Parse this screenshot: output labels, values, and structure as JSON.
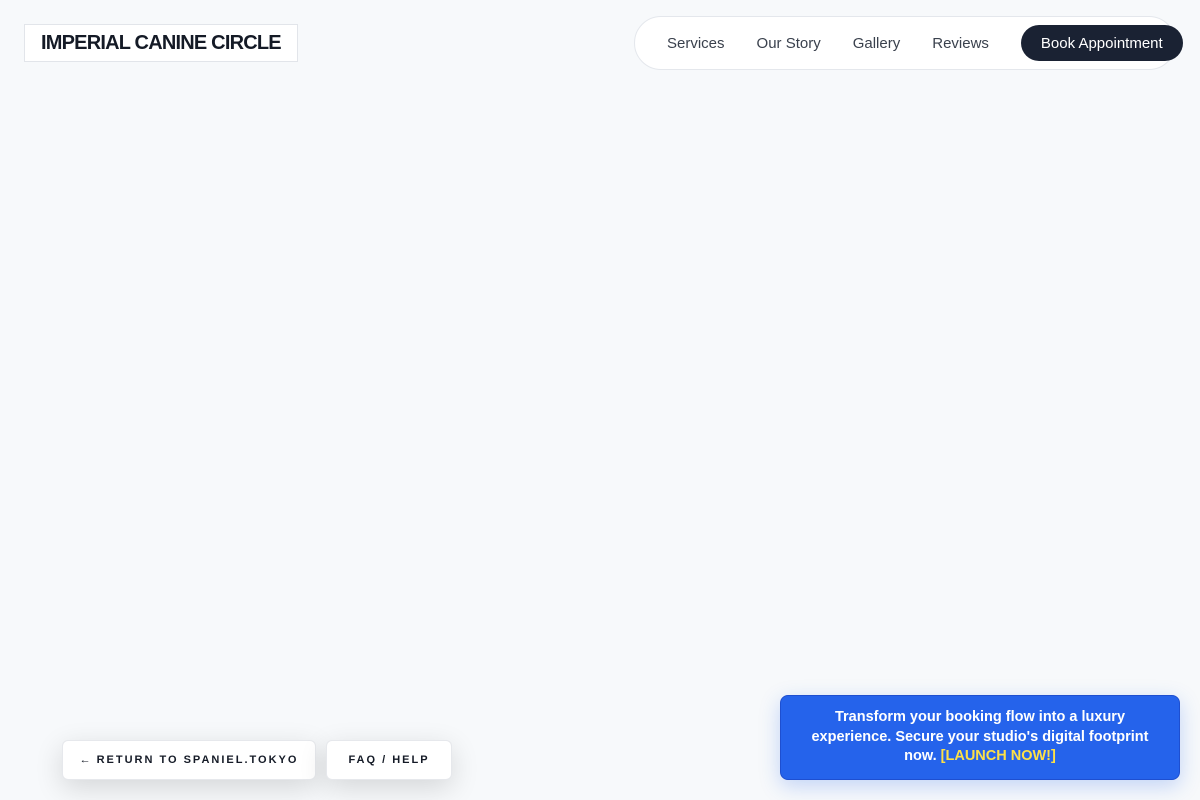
{
  "brand": {
    "name": "IMPERIAL CANINE CIRCLE"
  },
  "nav": {
    "links": [
      "Services",
      "Our Story",
      "Gallery",
      "Reviews"
    ],
    "cta_label": "Book Appointment"
  },
  "footer_buttons": {
    "return_arrow": "←",
    "return_label": "RETURN TO SPANIEL.TOKYO",
    "faq_label": "FAQ / HELP"
  },
  "promo": {
    "message": "Transform your booking flow into a luxury experience. Secure your studio's digital footprint now.",
    "cta_label": "[LAUNCH NOW!]"
  },
  "colors": {
    "background": "#f7f9fb",
    "brand_text": "#141a26",
    "nav_cta_bg": "#1a2233",
    "promo_bg": "#2563eb",
    "promo_cta": "#fde047"
  }
}
